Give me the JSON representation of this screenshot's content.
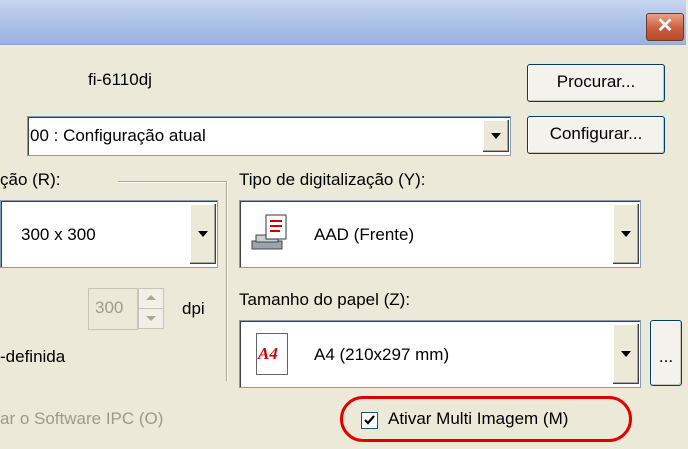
{
  "titlebar": {
    "close_icon": "close-icon"
  },
  "device": {
    "name": "fi-6110dj",
    "browse_label": "Procurar..."
  },
  "config": {
    "selected": "00 : Configuração atual",
    "configure_label": "Configurar..."
  },
  "resolution": {
    "label": "ção (R):",
    "selected": "300 x 300",
    "custom_value": "300",
    "unit": "dpi",
    "custom_label": "-definida"
  },
  "scan_type": {
    "label": "Tipo de digitalização (Y):",
    "selected": "AAD (Frente)",
    "icon": "scanner-icon"
  },
  "paper_size": {
    "label": "Tamanho do papel (Z):",
    "selected": "A4 (210x297 mm)",
    "icon_text": "A4",
    "more_label": "..."
  },
  "ipc": {
    "label": "ar o Software IPC (O)"
  },
  "multi_image": {
    "label": "Ativar Multi Imagem (M)",
    "checked": true,
    "highlight_color": "#e00000"
  }
}
